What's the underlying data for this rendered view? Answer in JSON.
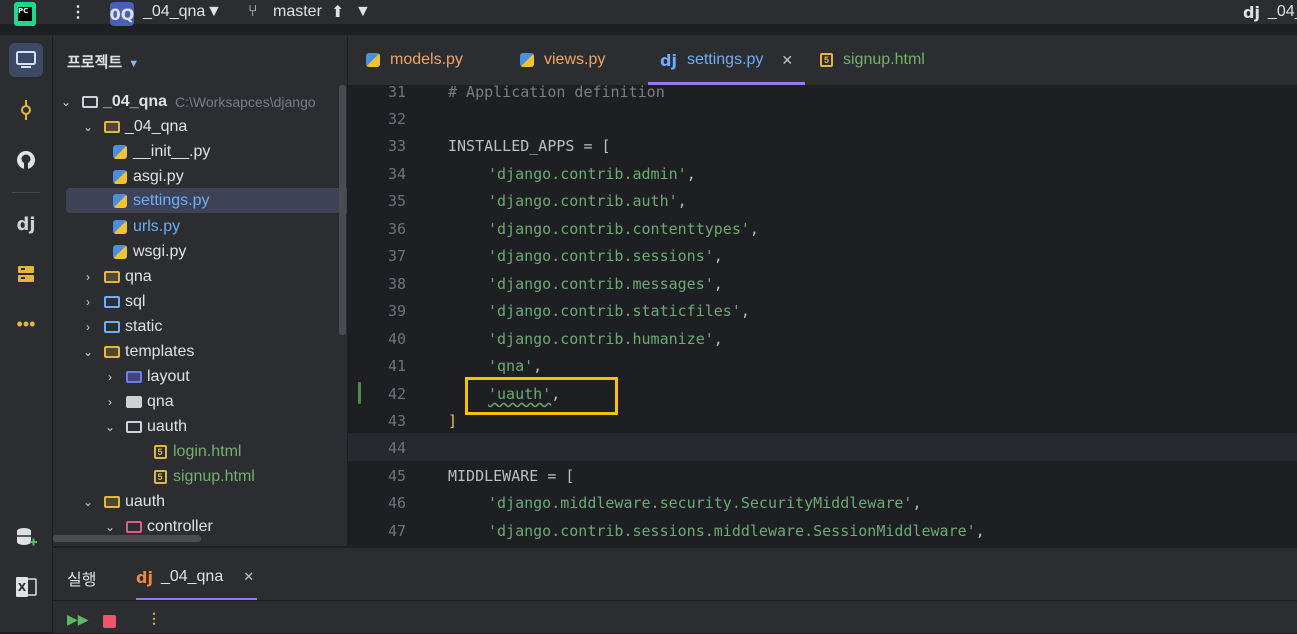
{
  "titlebar": {
    "project_badge": "0Q",
    "project_name": "_04_qna",
    "branch": "master",
    "run_config": "_04_",
    "run_config_icon": "dj"
  },
  "sidebar_icons": [
    "computer-icon",
    "commit-icon",
    "github-icon",
    "django-icon",
    "structure-icon",
    "more-icon",
    "database-add-icon",
    "excel-icon"
  ],
  "project_panel": {
    "title": "프로젝트",
    "rows": [
      {
        "label": "_04_qna",
        "extra": "C:\\Worksapces\\django",
        "bold": true
      },
      {
        "label": "_04_qna"
      },
      {
        "label": "__init__.py"
      },
      {
        "label": "asgi.py"
      },
      {
        "label": "settings.py"
      },
      {
        "label": "urls.py"
      },
      {
        "label": "wsgi.py"
      },
      {
        "label": "qna"
      },
      {
        "label": "sql"
      },
      {
        "label": "static"
      },
      {
        "label": "templates"
      },
      {
        "label": "layout"
      },
      {
        "label": "qna"
      },
      {
        "label": "uauth"
      },
      {
        "label": "login.html"
      },
      {
        "label": "signup.html"
      },
      {
        "label": "uauth"
      },
      {
        "label": "controller"
      }
    ]
  },
  "tabs": [
    {
      "label": "models.py",
      "icon": "python-icon"
    },
    {
      "label": "views.py",
      "icon": "python-icon"
    },
    {
      "label": "settings.py",
      "icon": "django-icon",
      "active": true,
      "icon_text": "dj"
    },
    {
      "label": "signup.html",
      "icon": "html-icon"
    }
  ],
  "editor": {
    "lines": [
      {
        "n": "31",
        "code": "# Application definition"
      },
      {
        "n": "32",
        "code": ""
      },
      {
        "n": "33",
        "code": "INSTALLED_APPS = ["
      },
      {
        "n": "34",
        "code": "'django.contrib.admin'"
      },
      {
        "n": "35",
        "code": "'django.contrib.auth'"
      },
      {
        "n": "36",
        "code": "'django.contrib.contenttypes'"
      },
      {
        "n": "37",
        "code": "'django.contrib.sessions'"
      },
      {
        "n": "38",
        "code": "'django.contrib.messages'"
      },
      {
        "n": "39",
        "code": "'django.contrib.staticfiles'"
      },
      {
        "n": "40",
        "code": "'django.contrib.humanize'"
      },
      {
        "n": "41",
        "code": "'qna'"
      },
      {
        "n": "42",
        "code": "'uauth'"
      },
      {
        "n": "43",
        "code": "]"
      },
      {
        "n": "44",
        "code": ""
      },
      {
        "n": "45",
        "code": "MIDDLEWARE = ["
      },
      {
        "n": "46",
        "code": "'django.middleware.security.SecurityMiddleware'"
      },
      {
        "n": "47",
        "code": "'django.contrib.sessions.middleware.SessionMiddleware'"
      }
    ]
  },
  "run_panel": {
    "title": "실행",
    "tab_label": "_04_qna",
    "tab_icon": "dj"
  },
  "colors": {
    "highlight_box": "#f5c400",
    "accent_underline": "#9b77f0",
    "string": "#6aab73"
  }
}
